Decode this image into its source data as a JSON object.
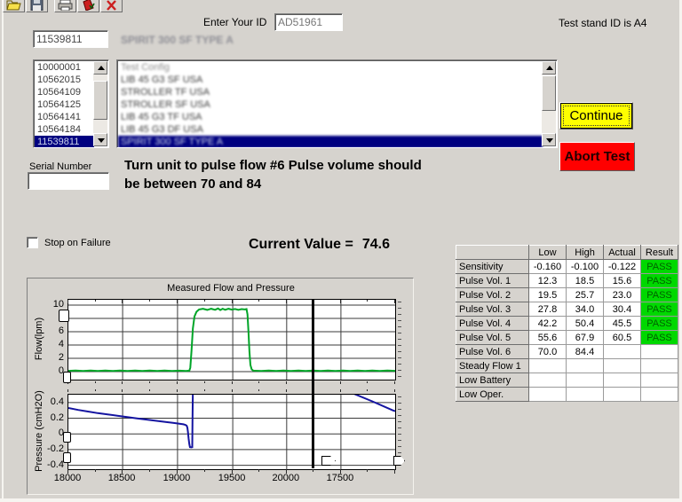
{
  "colors": {
    "background": "#d6d3ce",
    "selection_blue": "#000080",
    "continue_yellow": "#ffff00",
    "abort_red": "#ff0000",
    "pass_green": "#00d800",
    "flow_line": "#00a528",
    "pressure_line": "#1414a0"
  },
  "toolbar": {
    "icons": [
      "open-folder",
      "save",
      "print",
      "report",
      "cancel"
    ]
  },
  "header": {
    "enter_id_label": "Enter Your ID",
    "enter_id_value": "AD51961",
    "test_stand_text": "Test stand ID is A4",
    "unit_id_value": "11539811",
    "model_text_blurred": "SPIRIT 300 SF TYPE A"
  },
  "serial_list": {
    "items": [
      "10000001",
      "10562015",
      "10564109",
      "10564125",
      "10564141",
      "10564184",
      "11539811"
    ],
    "selected": "11539811"
  },
  "config_list": {
    "items_blurred": [
      "Test Config",
      "LIB 45 G3 SF USA",
      "STROLLER TF USA",
      "STROLLER SF USA",
      "LIB 45 G3 TF USA",
      "LIB 45 G3 DF USA"
    ],
    "selected_blurred": "SPIRIT 300 SF TYPE A"
  },
  "buttons": {
    "continue_label": "Continue",
    "abort_label": "Abort Test"
  },
  "serial_number": {
    "label": "Serial Number",
    "value": ""
  },
  "instruction": {
    "line1": "Turn unit to pulse flow #6 Pulse volume should",
    "line2": "be between 70 and 84"
  },
  "stop_on_failure": {
    "label": "Stop on Failure",
    "checked": false
  },
  "current_value": {
    "label": "Current Value =",
    "value": "74.6"
  },
  "results_table": {
    "columns": [
      "",
      "Low",
      "High",
      "Actual",
      "Result"
    ],
    "rows": [
      [
        "Sensitivity",
        "-0.160",
        "-0.100",
        "-0.122",
        "PASS"
      ],
      [
        "Pulse Vol. 1",
        "12.3",
        "18.5",
        "15.6",
        "PASS"
      ],
      [
        "Pulse Vol. 2",
        "19.5",
        "25.7",
        "23.0",
        "PASS"
      ],
      [
        "Pulse Vol. 3",
        "27.8",
        "34.0",
        "30.4",
        "PASS"
      ],
      [
        "Pulse Vol. 4",
        "42.2",
        "50.4",
        "45.5",
        "PASS"
      ],
      [
        "Pulse Vol. 5",
        "55.6",
        "67.9",
        "60.5",
        "PASS"
      ],
      [
        "Pulse Vol. 6",
        "70.0",
        "84.4",
        "",
        ""
      ],
      [
        "Steady Flow 1",
        "",
        "",
        "",
        ""
      ],
      [
        "Low Battery",
        "",
        "",
        "",
        ""
      ],
      [
        "Low Oper.",
        "",
        "",
        "",
        ""
      ]
    ]
  },
  "chart_data": [
    {
      "type": "line",
      "title": "Measured Flow and Pressure",
      "ylabel": "Flow(lpm)",
      "ylim": [
        -1.2,
        10.8
      ],
      "yticks": [
        10,
        8,
        6,
        4,
        2,
        0
      ],
      "grid": true,
      "cursor_frac": 0.753,
      "series": [
        {
          "name": "flow",
          "color": "#00a528",
          "points": [
            [
              0,
              0.12
            ],
            [
              0.022,
              0.18
            ],
            [
              0.045,
              0.1
            ],
            [
              0.068,
              0.17
            ],
            [
              0.09,
              0.1
            ],
            [
              0.113,
              0.16
            ],
            [
              0.136,
              0.1
            ],
            [
              0.158,
              0.17
            ],
            [
              0.181,
              0.11
            ],
            [
              0.204,
              0.16
            ],
            [
              0.226,
              0.1
            ],
            [
              0.249,
              0.16
            ],
            [
              0.272,
              0.1
            ],
            [
              0.294,
              0.17
            ],
            [
              0.317,
              0.1
            ],
            [
              0.34,
              0.15
            ],
            [
              0.36,
              0.1
            ],
            [
              0.37,
              0.15
            ],
            [
              0.373,
              0.6
            ],
            [
              0.377,
              3.2
            ],
            [
              0.381,
              6.5
            ],
            [
              0.386,
              8.3
            ],
            [
              0.392,
              9.0
            ],
            [
              0.4,
              9.35
            ],
            [
              0.412,
              9.45
            ],
            [
              0.425,
              9.28
            ],
            [
              0.437,
              9.45
            ],
            [
              0.449,
              9.3
            ],
            [
              0.458,
              9.5
            ],
            [
              0.465,
              9.25
            ],
            [
              0.472,
              9.45
            ],
            [
              0.48,
              9.3
            ],
            [
              0.49,
              9.45
            ],
            [
              0.5,
              9.32
            ],
            [
              0.51,
              9.42
            ],
            [
              0.52,
              9.3
            ],
            [
              0.53,
              9.4
            ],
            [
              0.54,
              9.35
            ],
            [
              0.545,
              9.4
            ],
            [
              0.548,
              8.6
            ],
            [
              0.551,
              6.0
            ],
            [
              0.554,
              3.0
            ],
            [
              0.557,
              1.0
            ],
            [
              0.561,
              0.35
            ],
            [
              0.566,
              0.15
            ],
            [
              0.59,
              0.1
            ],
            [
              0.613,
              0.16
            ],
            [
              0.636,
              0.1
            ],
            [
              0.658,
              0.16
            ],
            [
              0.681,
              0.1
            ],
            [
              0.704,
              0.16
            ],
            [
              0.726,
              0.1
            ],
            [
              0.749,
              0.16
            ],
            [
              0.772,
              0.1
            ],
            [
              0.794,
              0.16
            ],
            [
              0.817,
              0.1
            ],
            [
              0.84,
              0.16
            ],
            [
              0.862,
              0.1
            ],
            [
              0.885,
              0.16
            ],
            [
              0.908,
              0.1
            ],
            [
              0.93,
              0.16
            ],
            [
              0.953,
              0.1
            ],
            [
              0.976,
              0.16
            ],
            [
              1,
              0.12
            ]
          ]
        }
      ]
    },
    {
      "type": "line",
      "ylabel": "Pressure (cmH2O)",
      "ylim": [
        -0.45,
        0.5
      ],
      "yticks": [
        0.4,
        0.2,
        0,
        -0.2,
        -0.4
      ],
      "grid": true,
      "cursor_frac": 0.753,
      "xticks": [
        {
          "frac": 0.0,
          "label": "18000"
        },
        {
          "frac": 0.166,
          "label": "18500"
        },
        {
          "frac": 0.334,
          "label": "19000"
        },
        {
          "frac": 0.503,
          "label": "19500"
        },
        {
          "frac": 0.668,
          "label": "20000"
        },
        {
          "frac": 0.834,
          "label": "17500"
        }
      ],
      "series": [
        {
          "name": "pressure",
          "color": "#1414a0",
          "points": [
            [
              0,
              0.33
            ],
            [
              0.03,
              0.305
            ],
            [
              0.06,
              0.285
            ],
            [
              0.09,
              0.265
            ],
            [
              0.12,
              0.248
            ],
            [
              0.15,
              0.232
            ],
            [
              0.18,
              0.215
            ],
            [
              0.21,
              0.198
            ],
            [
              0.24,
              0.182
            ],
            [
              0.27,
              0.166
            ],
            [
              0.3,
              0.15
            ],
            [
              0.32,
              0.14
            ],
            [
              0.34,
              0.13
            ],
            [
              0.352,
              0.122
            ],
            [
              0.358,
              0.115
            ],
            [
              0.362,
              0.105
            ],
            [
              0.364,
              0.08
            ],
            [
              0.366,
              0.02
            ],
            [
              0.368,
              -0.06
            ],
            [
              0.37,
              -0.13
            ],
            [
              0.372,
              -0.168
            ],
            [
              0.376,
              -0.172
            ],
            [
              0.379,
              -0.17
            ],
            [
              0.38,
              0.2
            ],
            [
              0.381,
              0.55
            ]
          ]
        },
        {
          "name": "pressure-wrap",
          "color": "#1414a0",
          "points": [
            [
              0.872,
              0.515
            ],
            [
              0.93,
              0.415
            ],
            [
              0.993,
              0.3
            ],
            [
              1,
              0.29
            ]
          ]
        }
      ]
    }
  ]
}
